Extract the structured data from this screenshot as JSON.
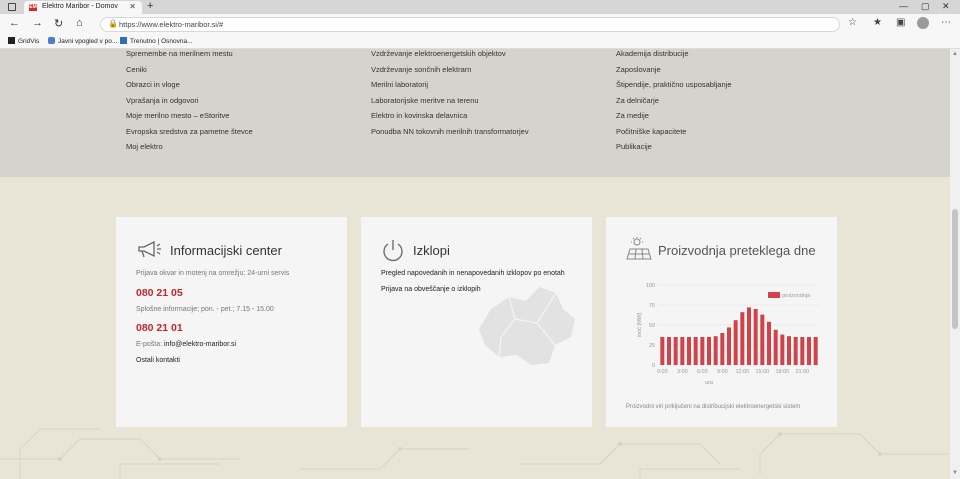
{
  "browser": {
    "tab_title": "Elektro Maribor - Domov",
    "tab_favicon": "EM",
    "url": "https://www.elektro-maribor.si/#",
    "bookmarks": [
      "GridVis",
      "Javni vpogled v po...",
      "Trenutno | Osnovna..."
    ]
  },
  "footer": {
    "col1": [
      "Spremembe na merilnem mestu",
      "Ceniki",
      "Obrazci in vloge",
      "Vprašanja in odgovori",
      "Moje merilno mesto – eStoritve",
      "Evropska sredstva za pametne števce",
      "Moj elektro"
    ],
    "col2": [
      "Vzdrževanje elektroenergetskih objektov",
      "Vzdrževanje sončnih elektrarn",
      "Merilni laboratorij",
      "Laboratorijske meritve na terenu",
      "Elektro in kovinska delavnica",
      "Ponudba NN tokovnih merilnih transformatorjev"
    ],
    "col3": [
      "Akademija distribucije",
      "Zaposlovanje",
      "Štipendije, praktično usposabljanje",
      "Za delničarje",
      "Za medije",
      "Počitniške kapacitete",
      "Publikacije"
    ]
  },
  "info_center": {
    "title": "Informacijski center",
    "fault_label": "Prijava okvar in motenj na omrežju; 24-urni servis",
    "fault_phone": "080 21 05",
    "general_label": "Splošne informacije; pon. - pet.; 7.15 - 15.00",
    "general_phone": "080 21 01",
    "email_label": "E-pošta:",
    "email": "info@elektro-maribor.si",
    "other_contacts": "Ostali kontakti"
  },
  "outages": {
    "title": "Izklopi",
    "link1": "Pregled napovedanih in nenapovedanih izklopov po enotah",
    "link2": "Prijava na obveščanje o izklopih"
  },
  "production": {
    "title": "Proizvodnja preteklega dne",
    "note": "Proizvodni viri priključeni na distribucijski elektroenergetski sistem"
  },
  "chart_data": {
    "type": "bar",
    "title": "Proizvodnja preteklega dne",
    "xlabel": "ura",
    "ylabel": "moč [MW]",
    "ylim": [
      0,
      100
    ],
    "yticks": [
      0,
      25,
      50,
      75,
      100
    ],
    "xticks": [
      "0:00",
      "3:00",
      "6:00",
      "9:00",
      "12:00",
      "15:00",
      "18:00",
      "21:00"
    ],
    "series": [
      {
        "name": "proizvodnja",
        "color": "#d0434a",
        "values": [
          35,
          35,
          35,
          35,
          35,
          35,
          35,
          35,
          36,
          40,
          47,
          56,
          66,
          72,
          70,
          63,
          54,
          44,
          38,
          36,
          35,
          35,
          35,
          35
        ]
      }
    ]
  }
}
